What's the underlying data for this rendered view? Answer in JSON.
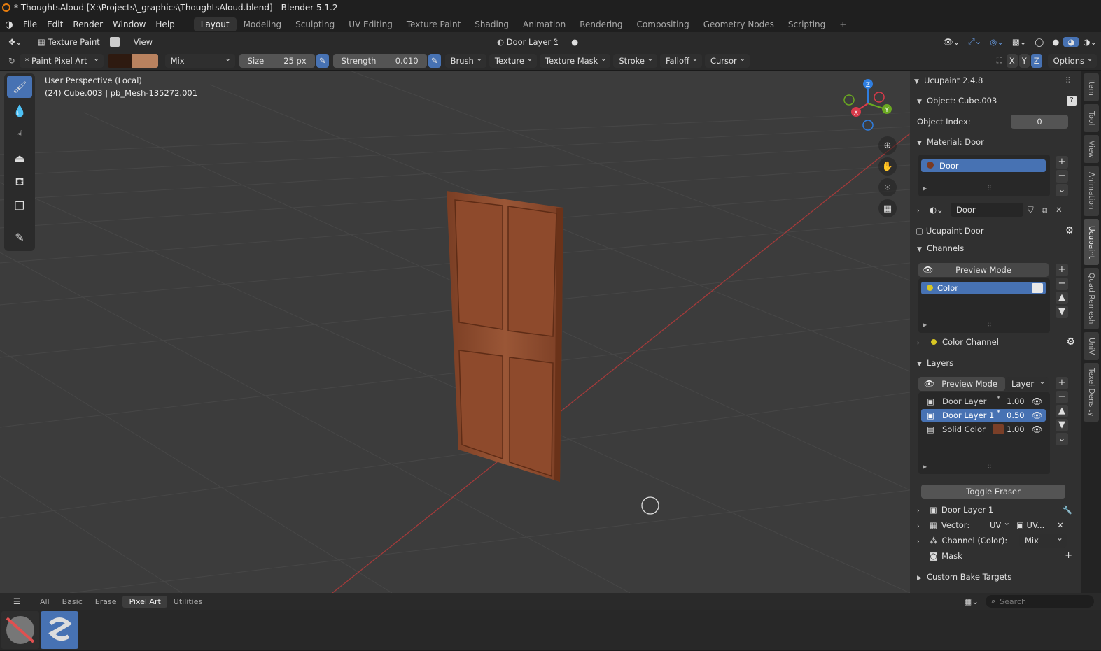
{
  "title": "* ThoughtsAloud [X:\\Projects\\_graphics\\ThoughtsAloud.blend] - Blender 5.1.2",
  "menu": [
    "File",
    "Edit",
    "Render",
    "Window",
    "Help"
  ],
  "workspaces": [
    "Layout",
    "Modeling",
    "Sculpting",
    "UV Editing",
    "Texture Paint",
    "Shading",
    "Animation",
    "Rendering",
    "Compositing",
    "Geometry Nodes",
    "Scripting"
  ],
  "header": {
    "mode": "Texture Paint",
    "view": "View",
    "layer_select": "Door Layer 1"
  },
  "tool_header": {
    "brush": "* Paint Pixel Art",
    "color_primary": "#2e1a10",
    "color_secondary": "#b9825f",
    "blend": "Mix",
    "size_label": "Size",
    "size_value": "25 px",
    "strength_label": "Strength",
    "strength_value": "0.010",
    "menus": [
      "Brush",
      "Texture",
      "Texture Mask",
      "Stroke",
      "Falloff",
      "Cursor"
    ],
    "axes": [
      "X",
      "Y",
      "Z"
    ],
    "options": "Options"
  },
  "viewport": {
    "perspective": "User Perspective (Local)",
    "object_info": "(24) Cube.003 | pb_Mesh-135272.001",
    "gizmo": {
      "x": "X",
      "y": "Y",
      "z": "Z"
    }
  },
  "npanel": {
    "addon": "Ucupaint 2.4.8",
    "object": "Object: Cube.003",
    "object_index_label": "Object Index:",
    "object_index": "0",
    "material_header": "Material: Door",
    "material_slot": "Door",
    "material_name": "Door",
    "ucupaint_name": "Ucupaint Door",
    "channels_header": "Channels",
    "channels_preview": "Preview Mode",
    "channel_item": "Color",
    "color_channel": "Color Channel",
    "layers_header": "Layers",
    "layers_preview": "Preview Mode",
    "layers_mode": "Layer",
    "layers": [
      {
        "name": "Door Layer",
        "value": "1.00"
      },
      {
        "name": "Door Layer 1",
        "value": "0.50"
      },
      {
        "name": "Solid Color",
        "value": "1.00"
      }
    ],
    "toggle_eraser": "Toggle Eraser",
    "layer_detail": "Door Layer 1",
    "vector_label": "Vector:",
    "vector_type": "UV",
    "vector_map": "UV...",
    "channel_color_label": "Channel (Color):",
    "channel_color_mode": "Mix",
    "mask": "Mask",
    "custom_bake": "Custom Bake Targets"
  },
  "side_tabs": [
    "Item",
    "Tool",
    "View",
    "Animation",
    "Ucupaint",
    "Quad Remesh",
    "UniV",
    "Texel Density"
  ],
  "asset_tabs": [
    "All",
    "Basic",
    "Erase",
    "Pixel Art",
    "Utilities"
  ],
  "search_placeholder": "Search"
}
